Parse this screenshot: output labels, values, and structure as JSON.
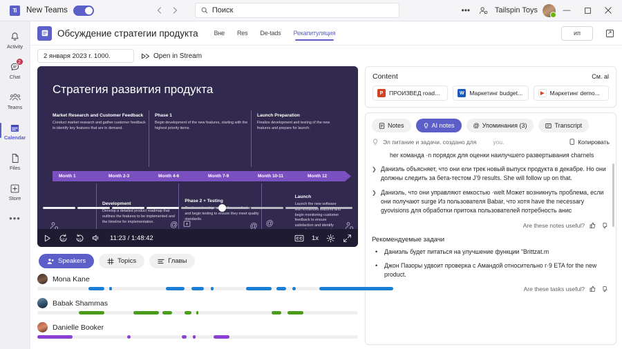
{
  "titlebar": {
    "app_label": "New Teams",
    "toggle_on": true,
    "search_placeholder": "Поиск",
    "org_name": "Tailspin Toys",
    "more_icon": "more-horizontal-icon",
    "people_icon": "people-add-icon",
    "minimize": "—",
    "maximize": "▢",
    "close": "✕"
  },
  "rail": {
    "items": [
      {
        "label": "Activity",
        "icon": "bell-icon",
        "badge": ""
      },
      {
        "label": "Chat",
        "icon": "chat-icon",
        "badge": "2"
      },
      {
        "label": "Teams",
        "icon": "people-icon",
        "badge": ""
      },
      {
        "label": "Calendar",
        "icon": "calendar-icon",
        "badge": ""
      },
      {
        "label": "Files",
        "icon": "file-icon",
        "badge": ""
      },
      {
        "label": "Store",
        "icon": "plus-box-icon",
        "badge": ""
      }
    ],
    "active_index": 3,
    "more": "•••"
  },
  "meeting": {
    "title": "Обсуждение стратегии продукта",
    "tabs": [
      {
        "label": "Вне"
      },
      {
        "label": "Res"
      },
      {
        "label": "De-tads"
      },
      {
        "label": "Рекапитуляция"
      }
    ],
    "active_tab": 3,
    "join_button": "ип",
    "popout_icon": "popout-icon",
    "date_value": "2 января 2023 г. 1000.",
    "stream_link": "Open in Stream",
    "stream_icon": "stream-icon"
  },
  "slide": {
    "title": "Стратегия развития продукта",
    "top_blocks": [
      {
        "heading": "Market Research and Customer Feedback",
        "text": "Conduct market research and gather customer feedback to identify key features that are in demand."
      },
      {
        "heading": "Phase 1",
        "text": "Begin development of the new features, starting with the highest priority items."
      },
      {
        "heading": "Launch Preparation",
        "text": "Finalize development and testing of the new features and prepare for launch."
      }
    ],
    "months": [
      "Month 1",
      "Month 2-3",
      "Month 4-6",
      "Month 7-9",
      "Month 10-11",
      "Month 12"
    ],
    "bottom_blocks": [
      {
        "heading": "Development",
        "text": "Develop a detailed product roadmap that outlines the features to be implemented and the timeline for implementation."
      },
      {
        "heading": "Phase 2 + Testing",
        "text": "Continue development of the new features and begin testing to ensure they meet quality standards."
      },
      {
        "heading": "Launch",
        "text": "Launch the new software with enhanced features and begin monitoring customer feedback to ensure satisfaction and identify areas for improvement."
      }
    ]
  },
  "player": {
    "play_icon": "play-icon",
    "rewind_icon": "rewind-10-icon",
    "forward_icon": "forward-10-icon",
    "volume_icon": "volume-icon",
    "time": "11:23 / 1:48:42",
    "cc_icon": "closed-caption-icon",
    "rate": "1x",
    "settings_icon": "gear-icon",
    "fullscreen_icon": "fullscreen-icon",
    "progress_percent": 11
  },
  "speakers_panel": {
    "tabs": [
      {
        "label": "Speakers",
        "icon": "people-icon"
      },
      {
        "label": "Topics",
        "icon": "hash-icon"
      },
      {
        "label": "Главы",
        "icon": "list-icon"
      }
    ],
    "active_tab": 0,
    "speakers": [
      {
        "name": "Mona Kane",
        "color": "#1a7fd4",
        "segments": [
          [
            16,
            5
          ],
          [
            22,
            0.8
          ],
          [
            40,
            6
          ],
          [
            48,
            4
          ],
          [
            54,
            1
          ],
          [
            65,
            8
          ],
          [
            75,
            3
          ],
          [
            80,
            0.9
          ],
          [
            88,
            23
          ]
        ]
      },
      {
        "name": "Babak Shammas",
        "color": "#4b9b1d",
        "segments": [
          [
            13,
            8
          ],
          [
            30,
            8
          ],
          [
            39,
            3
          ],
          [
            46,
            2
          ],
          [
            49,
            0.8
          ],
          [
            73,
            3
          ],
          [
            78,
            5
          ]
        ]
      },
      {
        "name": "Danielle Booker",
        "color": "#8b3fd4",
        "segments": [
          [
            0,
            11
          ],
          [
            28,
            1
          ],
          [
            45,
            1.6
          ],
          [
            48,
            0.9
          ],
          [
            55,
            5
          ]
        ]
      }
    ]
  },
  "content_panel": {
    "title": "Content",
    "see_all": "См. al",
    "files": [
      {
        "name": "ПРОИЗВЕД roadmap...",
        "type": "ppt"
      },
      {
        "name": "Маркетинг budget...",
        "type": "doc"
      },
      {
        "name": "Маркетинг demo...",
        "type": "vid"
      }
    ]
  },
  "notes_panel": {
    "tabs": [
      {
        "label": "Notes",
        "icon": "note-icon"
      },
      {
        "label": "AI notes",
        "icon": "bulb-icon"
      },
      {
        "label": "Упоминания (3)",
        "icon": "at-icon"
      },
      {
        "label": "Transcript",
        "icon": "transcript-icon"
      }
    ],
    "active_tab": 1,
    "meta": "Эл питание и задачи. создано для",
    "meta_suffix": "you.",
    "meta_icon": "bulb-icon",
    "copy_label": "Копировать",
    "copy_icon": "copy-icon",
    "intro": "her команда ­­·n порядок для оценки наилучшего развертывания charnels",
    "notes": [
      "Даниэль объясняет, что они ели трек новый выпуск продукта в декабре. Но они должны следить за бета-тестом J’9 results. She will follow up on that.",
      "Даниэль, что они управляют емкостью ·welt Может возникнуть проблема, если они получают surge Из пользователя Babar, что хотя have the necessary gyovisions для обработки притока пользователей потребность анис"
    ],
    "notes_feedback": "Are these notes useful?",
    "tasks_title": "Рекомендуемые задачи",
    "tasks": [
      "Даниэль будет питаться на улучшение функции \"Brittzat.m",
      "Джон Пазоры удвоит проверка с Амандой относительно r·9 ETA  for the new product."
    ],
    "tasks_feedback": "Are these tasks useful?",
    "thumb_up": "thumbs-up-icon",
    "thumb_down": "thumbs-down-icon"
  },
  "colors": {
    "accent": "#5b5fc7",
    "badge": "#c4314b",
    "slide_bg": "#322a4e",
    "month_bar": "#7a4fbf"
  }
}
